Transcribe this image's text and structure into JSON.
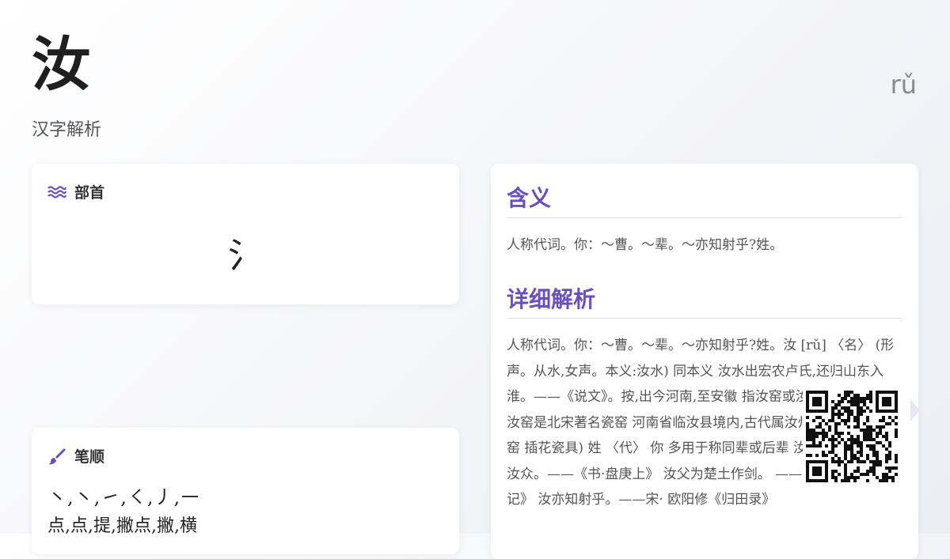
{
  "header": {
    "character": "汝",
    "subtitle": "汉字解析",
    "pinyin": "rǔ"
  },
  "radical": {
    "label": "部首",
    "icon": "water-waves-icon",
    "glyph": "氵"
  },
  "strokes": {
    "label": "笔顺",
    "icon": "brush-icon",
    "sequence": "㇔,㇔,㇀,㇛,㇓,㇐",
    "names": "点,点,提,撇点,撇,横"
  },
  "meaning": {
    "title": "含义",
    "text": "人称代词。你：～曹。～辈。～亦知射乎?姓。"
  },
  "detail": {
    "title": "详细解析",
    "text": "人称代词。你：～曹。～辈。～亦知射乎?姓。汝 [rǔ] 〈名〉 (形声。从水,女声。本义:汝水) 同本义 汝水出宏农卢氏,还归山东入 淮。——《说文》。按,出今河南,至安徽 指汝窑或汝窑所产瓷器 。汝窑是北宋著名瓷窑 河南省临汝县境内,古代属汝州,故名。 如:汝窑 插花瓷具) 姓 〈代〉 你 多用于称同辈或后辈 汝 《书·舜典》 格汝众。——《书·盘庚上》 汝父为楚土作剑。 —— 晋· 干宝《搜神记》 汝亦知射乎。——宋· 欧阳修《归田录》"
  },
  "colors": {
    "accent": "#6a4fc2",
    "background": "#f3f4f8"
  }
}
